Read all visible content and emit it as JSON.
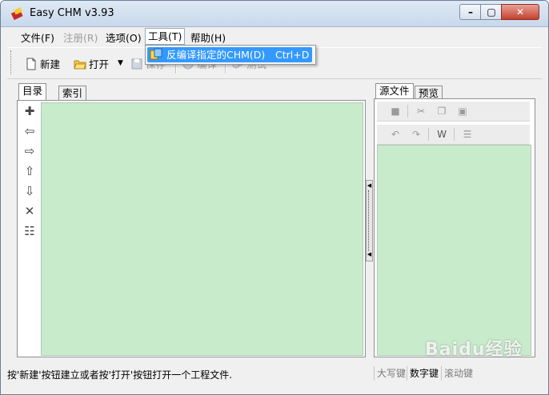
{
  "window": {
    "title": "Easy CHM v3.93"
  },
  "menubar": [
    {
      "label": "文件(F)"
    },
    {
      "label": "注册(R)"
    },
    {
      "label": "选项(O)"
    },
    {
      "label": "工具(T)"
    },
    {
      "label": "帮助(H)"
    }
  ],
  "toolbar": {
    "new_label": "新建",
    "open_label": "打开",
    "save_label": "保存",
    "compile_label": "编译",
    "test_label": "测试"
  },
  "dropdown": {
    "item_label": "反编译指定的CHM(D)",
    "item_shortcut": "Ctrl+D"
  },
  "left_tabs": [
    "目录",
    "索引"
  ],
  "right_tabs": [
    "源文件",
    "预览"
  ],
  "statusbar": {
    "message": "按'新建'按钮建立或者按'打开'按钮打开一个工程文件.",
    "caps": "大写键",
    "num": "数字键",
    "scroll": "滚动键"
  },
  "watermark": "Baidu经验",
  "colors": {
    "editor_bg": "#c8ebcc",
    "menu_highlight": "#3399ff"
  }
}
